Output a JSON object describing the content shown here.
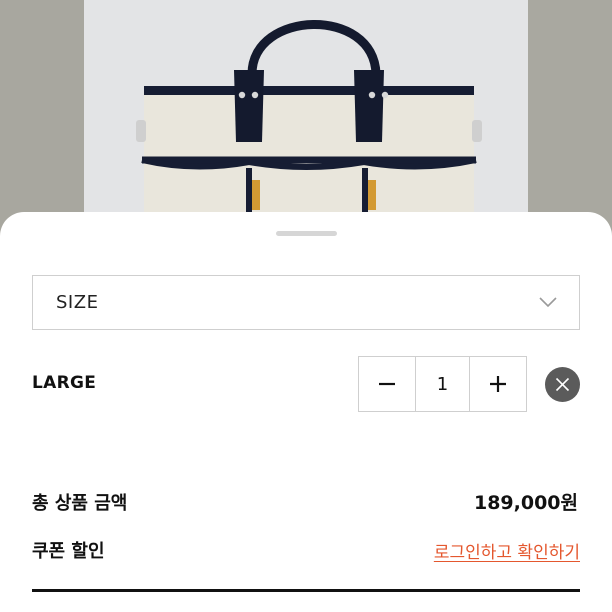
{
  "product_image": {
    "alt_icon": "canvas-tote-bag-image"
  },
  "option_sheet": {
    "select": {
      "label": "SIZE",
      "icon": "chevron-down-icon"
    },
    "selected_item": {
      "name": "LARGE",
      "quantity": "1",
      "decrement_icon": "minus-icon",
      "increment_icon": "plus-icon",
      "remove_icon": "close-icon"
    },
    "summary": {
      "total_label": "총 상품 금액",
      "total_value": "189,000원",
      "coupon_label": "쿠폰 할인",
      "coupon_link": "로그인하고 확인하기"
    }
  },
  "colors": {
    "accent_link": "#e4572e",
    "border": "#cfcfcf",
    "remove_button": "#5b5b5b"
  }
}
